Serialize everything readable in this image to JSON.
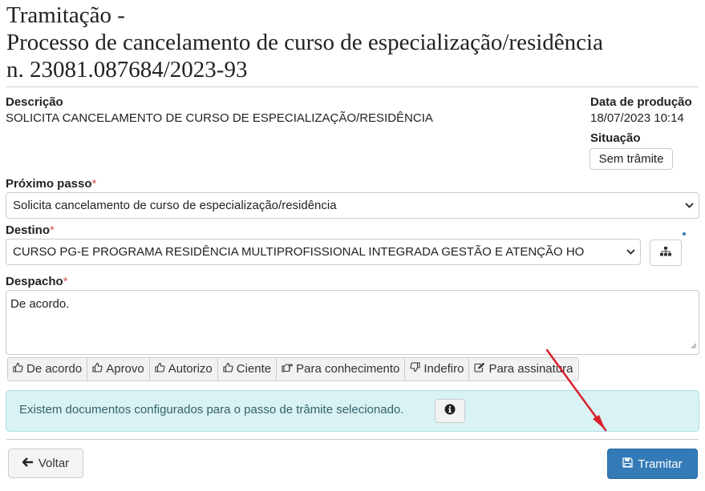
{
  "header": {
    "title_line1": "Tramitação -",
    "title_line2": "Processo de cancelamento de curso de especialização/residência",
    "title_line3": "n. 23081.087684/2023-93"
  },
  "info": {
    "descricao_label": "Descrição",
    "descricao_value": "SOLICITA CANCELAMENTO DE CURSO DE ESPECIALIZAÇÃO/RESIDÊNCIA",
    "data_label": "Data de produção",
    "data_value": "18/07/2023 10:14",
    "situacao_label": "Situação",
    "situacao_value": "Sem trâmite"
  },
  "form": {
    "proximo_passo_label": "Próximo passo",
    "proximo_passo_value": "Solicita cancelamento de curso de especialização/residência",
    "destino_label": "Destino",
    "destino_value": "CURSO PG-E PROGRAMA RESIDÊNCIA MULTIPROFISSIONAL INTEGRADA GESTÃO E ATENÇÃO HO",
    "despacho_label": "Despacho",
    "despacho_value": "De acordo.",
    "required_mark": "*"
  },
  "quick_buttons": [
    {
      "label": "De acordo",
      "icon": "thumbs-up-icon"
    },
    {
      "label": "Aprovo",
      "icon": "thumbs-up-icon"
    },
    {
      "label": "Autorizo",
      "icon": "thumbs-up-icon"
    },
    {
      "label": "Ciente",
      "icon": "thumbs-up-icon"
    },
    {
      "label": "Para conhecimento",
      "icon": "hand-point-right-icon"
    },
    {
      "label": "Indefiro",
      "icon": "thumbs-down-icon"
    },
    {
      "label": "Para assinatura",
      "icon": "edit-icon"
    }
  ],
  "alert": {
    "message": "Existem documentos configurados para o passo de trâmite selecionado."
  },
  "actions": {
    "back_label": "Voltar",
    "submit_label": "Tramitar"
  },
  "colors": {
    "primary": "#337ab7",
    "alert_bg": "#d9f3f5",
    "required": "#d9534f",
    "annotation_arrow": "#d9202a"
  }
}
